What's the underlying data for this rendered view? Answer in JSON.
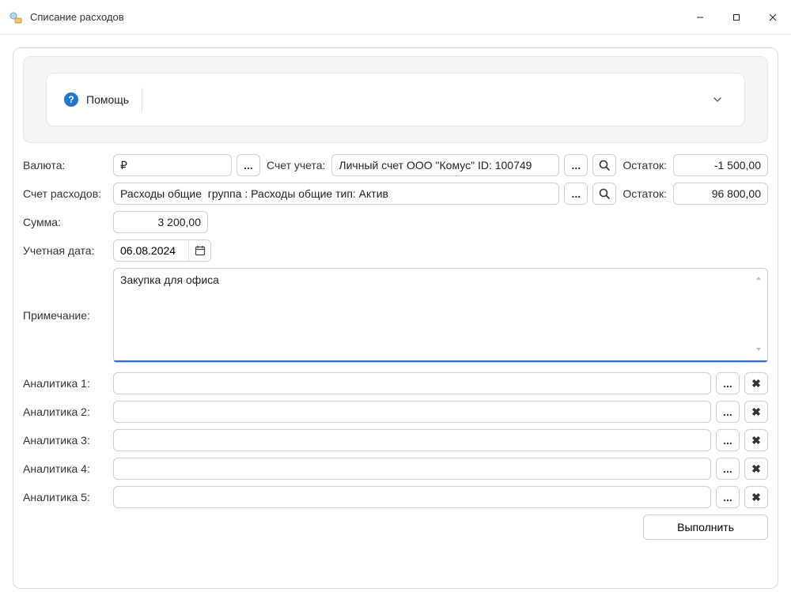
{
  "window": {
    "title": "Списание расходов"
  },
  "help": {
    "label": "Помощь"
  },
  "currency": {
    "label": "Валюта:",
    "value": "₽"
  },
  "account": {
    "label": "Счет учета:",
    "value": "Личный счет ООО \"Комус\" ID: 100749",
    "balance_label": "Остаток:",
    "balance_value": "-1 500,00"
  },
  "expense_account": {
    "label": "Счет расходов:",
    "value": "Расходы общие  группа : Расходы общие тип: Актив",
    "balance_label": "Остаток:",
    "balance_value": "96 800,00"
  },
  "amount": {
    "label": "Сумма:",
    "value": "3 200,00"
  },
  "date": {
    "label": "Учетная дата:",
    "value": "06.08.2024"
  },
  "note": {
    "label": "Примечание:",
    "value": "Закупка для офиса"
  },
  "analytics": [
    {
      "label": "Аналитика 1:",
      "value": ""
    },
    {
      "label": "Аналитика 2:",
      "value": ""
    },
    {
      "label": "Аналитика 3:",
      "value": ""
    },
    {
      "label": "Аналитика 4:",
      "value": ""
    },
    {
      "label": "Аналитика 5:",
      "value": ""
    }
  ],
  "buttons": {
    "execute": "Выполнить",
    "dots": "...",
    "x": "✖"
  }
}
